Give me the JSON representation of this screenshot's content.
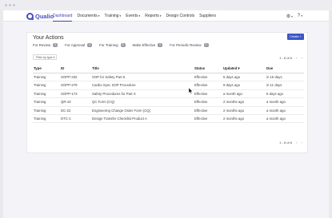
{
  "nav": {
    "logo_text": "Qualio",
    "items": [
      {
        "label": "Dashboard",
        "caret": ""
      },
      {
        "label": "Documents",
        "caret": "▾"
      },
      {
        "label": "Training",
        "caret": "▾"
      },
      {
        "label": "Events",
        "caret": "▾"
      },
      {
        "label": "Reports",
        "caret": "▾"
      },
      {
        "label": "Design Controls",
        "caret": ""
      },
      {
        "label": "Suppliers",
        "caret": ""
      }
    ],
    "settings_icon": "gear-icon",
    "help_icon": "question-icon",
    "dropdown_caret": "▾"
  },
  "actions": {
    "title": "Your Actions",
    "create_label": "Create +",
    "filters": [
      {
        "label": "For Review",
        "count": "0"
      },
      {
        "label": "For Approval",
        "count": "0"
      },
      {
        "label": "For Training",
        "count": "6"
      },
      {
        "label": "Make Effective",
        "count": "0"
      },
      {
        "label": "For Periodic Review",
        "count": "0"
      }
    ],
    "filter_by_type": "Filter by type ▾",
    "pagination": "1 - 6 of 6",
    "prev_arrow": "‹",
    "next_arrow": "›",
    "columns": {
      "type": "Type",
      "id": "ID",
      "title": "Title",
      "status": "Status",
      "updated": "Updated ▾",
      "due": "Due"
    },
    "rows": [
      {
        "type": "Training",
        "id": "SOPP-332",
        "title": "SOP for Safety Part 5",
        "status": "Effective",
        "updated": "5 days ago",
        "due": "in 15 days"
      },
      {
        "type": "Training",
        "id": "SOPP-279",
        "title": "Cardio Sync SOP Procedure",
        "status": "Effective",
        "updated": "9 days ago",
        "due": "in 11 days"
      },
      {
        "type": "Training",
        "id": "SOPP-173",
        "title": "Safety Procedures for Part X",
        "status": "Effective",
        "updated": "a month ago",
        "due": "6 days ago"
      },
      {
        "type": "Training",
        "id": "QR-10",
        "title": "QC Form (CQ)",
        "status": "Effective",
        "updated": "2 months ago",
        "due": "a month ago"
      },
      {
        "type": "Training",
        "id": "DC-22",
        "title": "Engineering Change Order Form (CQ)",
        "status": "Effective",
        "updated": "2 months ago",
        "due": "a month ago"
      },
      {
        "type": "Training",
        "id": "DTC-1",
        "title": "Design Transfer Checklist Product A",
        "status": "Effective",
        "updated": "2 months ago",
        "due": "a month ago"
      }
    ]
  }
}
